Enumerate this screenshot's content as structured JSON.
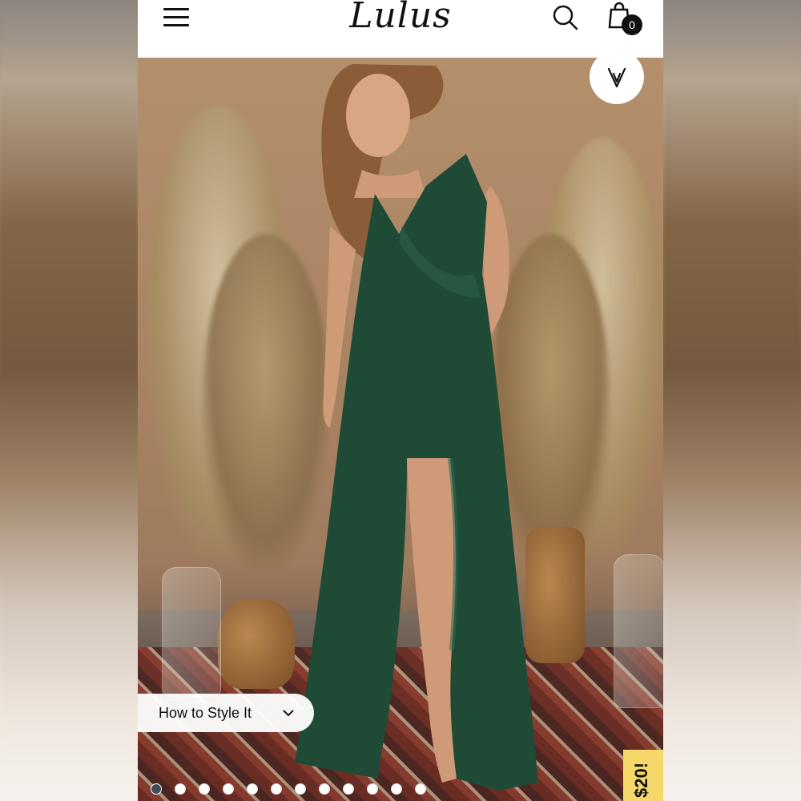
{
  "header": {
    "logo": "Lulus",
    "bag_count": "0"
  },
  "product": {
    "style_label": "How to Style It",
    "image_count": 12,
    "active_image": 1
  },
  "promo": {
    "label": "$20!"
  },
  "colors": {
    "dress": "#1f4a36",
    "promo_bg": "#f6d86a",
    "dot_active": "#3d4c5c"
  }
}
